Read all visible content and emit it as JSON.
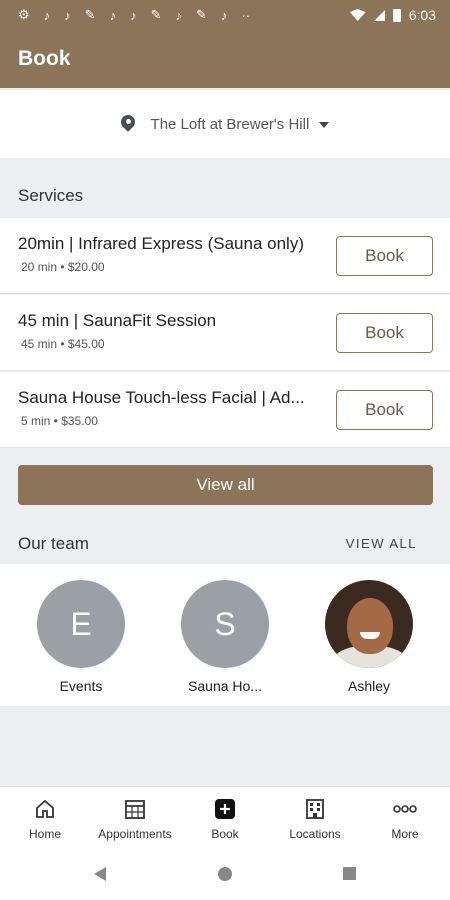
{
  "status_bar": {
    "time": "6:03",
    "notification_icons": [
      "⚙",
      "♪",
      "♪",
      "✎",
      "♪",
      "♪",
      "✎",
      "♪",
      "✎",
      "♪",
      "··"
    ]
  },
  "app_bar": {
    "title": "Book"
  },
  "location": {
    "name": "The Loft at Brewer's Hill"
  },
  "services": {
    "title": "Services",
    "items": [
      {
        "name": "20min | Infrared Express (Sauna only)",
        "meta": "20 min • $20.00",
        "button": "Book"
      },
      {
        "name": "45 min | SaunaFit Session",
        "meta": "45 min • $45.00",
        "button": "Book"
      },
      {
        "name": "Sauna House Touch-less Facial | Ad...",
        "meta": "5 min • $35.00",
        "button": "Book"
      }
    ],
    "view_all": "View all"
  },
  "team": {
    "title": "Our team",
    "view_all": "VIEW ALL",
    "members": [
      {
        "initial": "E",
        "name": "Events"
      },
      {
        "initial": "S",
        "name": "Sauna Ho..."
      },
      {
        "initial": "",
        "name": "Ashley"
      }
    ]
  },
  "bottom_nav": {
    "items": [
      {
        "label": "Home",
        "icon": "home-icon"
      },
      {
        "label": "Appointments",
        "icon": "calendar-icon"
      },
      {
        "label": "Book",
        "icon": "plus-icon"
      },
      {
        "label": "Locations",
        "icon": "building-icon"
      },
      {
        "label": "More",
        "icon": "more-icon"
      }
    ]
  },
  "colors": {
    "brand": "#8b7458",
    "background": "#eceef0",
    "avatar_gray": "#9aa0a6"
  }
}
